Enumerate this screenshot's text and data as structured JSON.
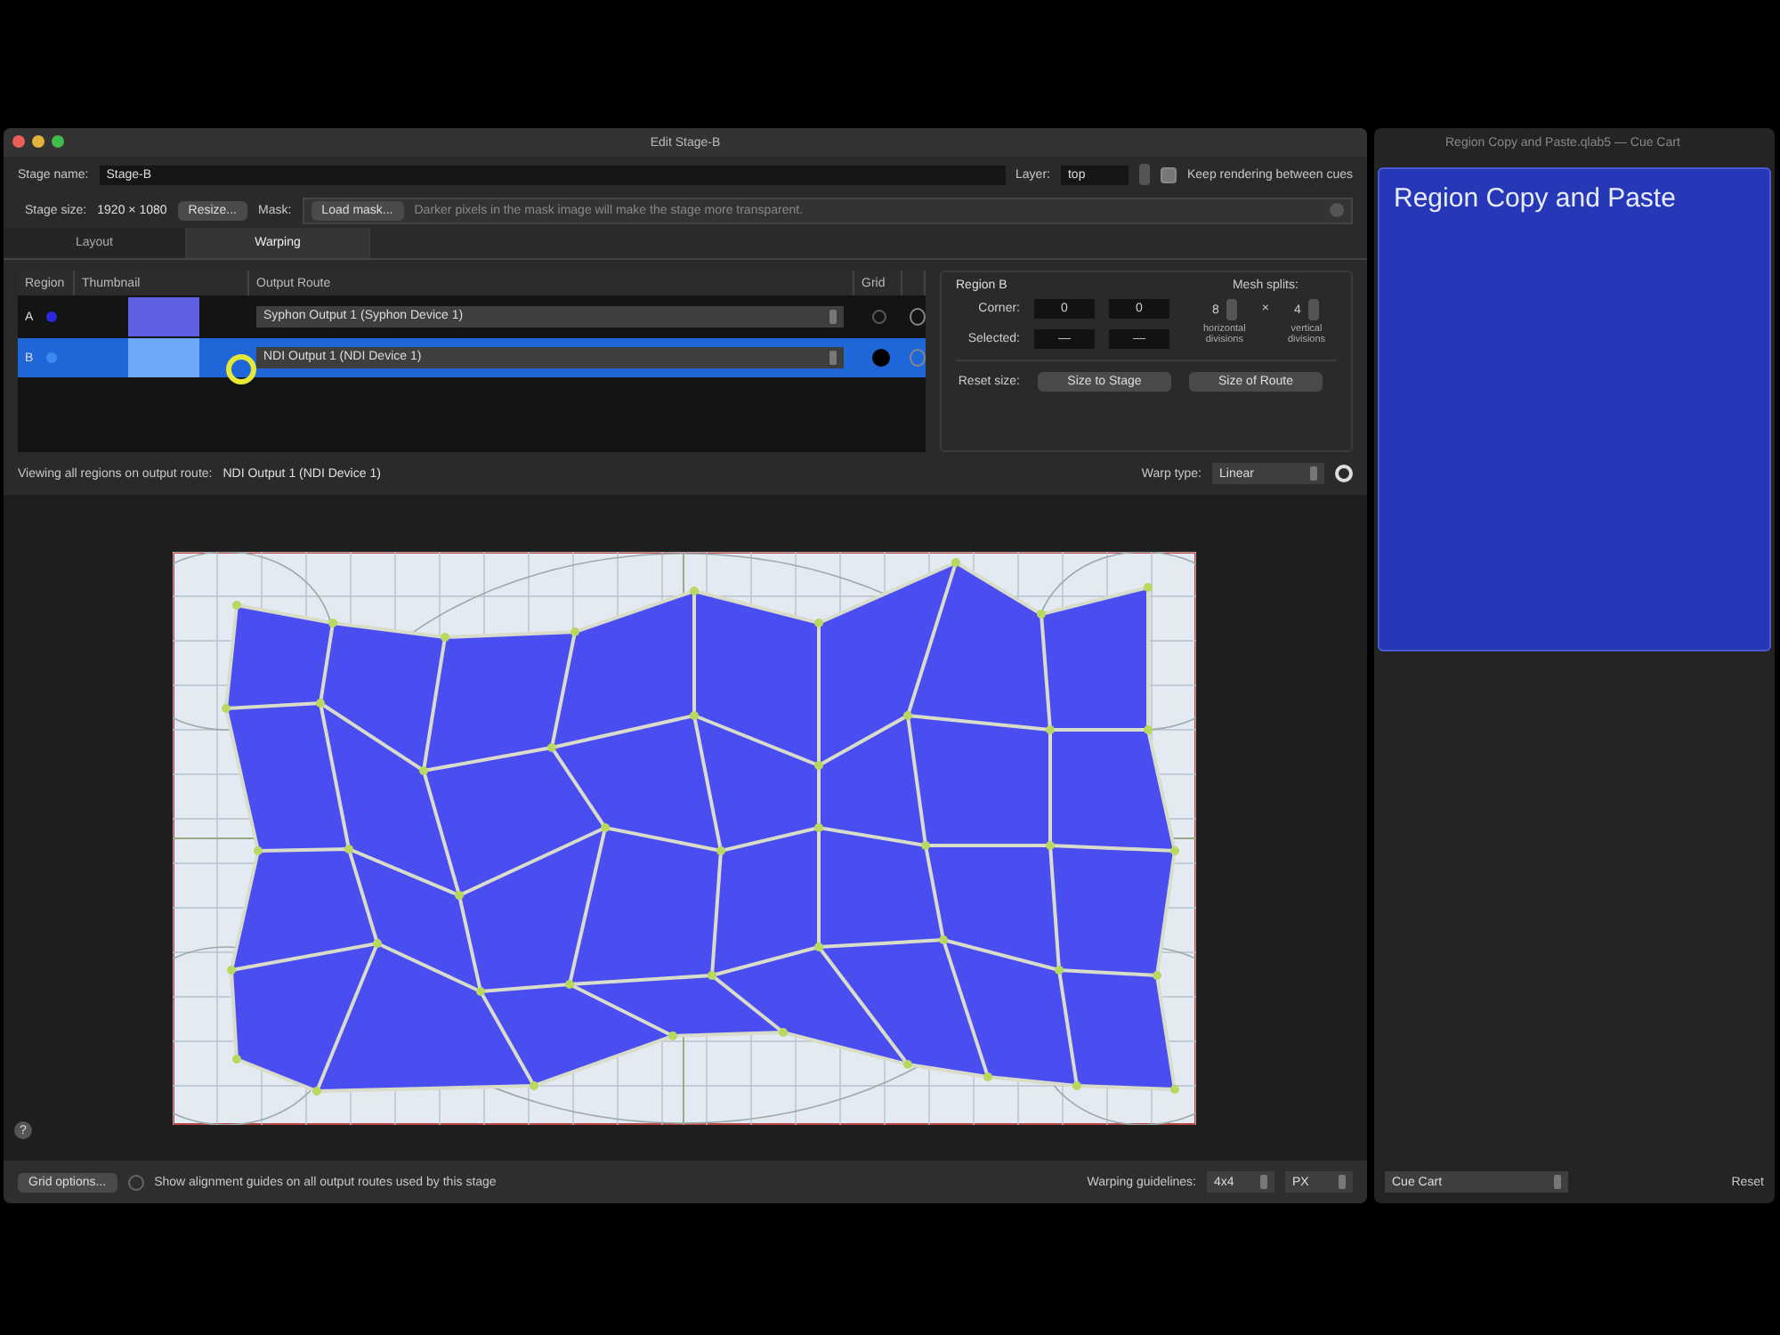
{
  "window": {
    "title": "Edit Stage-B"
  },
  "stage_name": {
    "label": "Stage name:",
    "value": "Stage-B"
  },
  "layer": {
    "label": "Layer:",
    "value": "top"
  },
  "keep_rendering": {
    "label": "Keep rendering between cues",
    "checked": true
  },
  "stage_size": {
    "label": "Stage size:",
    "value": "1920 × 1080",
    "button": "Resize..."
  },
  "mask": {
    "label": "Mask:",
    "button": "Load mask...",
    "hint": "Darker pixels in the mask image will make the stage more transparent."
  },
  "tabs": [
    {
      "label": "Layout",
      "selected": false
    },
    {
      "label": "Warping",
      "selected": true
    }
  ],
  "regions": {
    "columns": [
      "Region",
      "Thumbnail",
      "Output Route",
      "Grid"
    ],
    "rows": [
      {
        "region": "A",
        "color": "#2a2ad8",
        "route": "Syphon Output 1 (Syphon Device 1)",
        "grid": false,
        "selected": false
      },
      {
        "region": "B",
        "color": "#3a8cf0",
        "route": "NDI Output 1 (NDI Device 1)",
        "grid": true,
        "selected": true
      }
    ]
  },
  "viewing": {
    "label": "Viewing all regions on output route:",
    "value": "NDI Output 1 (NDI Device 1)"
  },
  "region_panel": {
    "title": "Region B",
    "corner_label": "Corner:",
    "corner": [
      "0",
      "0"
    ],
    "selected_label": "Selected:",
    "selected_values": [
      "—",
      "—"
    ],
    "mesh_label": "Mesh splits:",
    "h_splits": "8",
    "times": "×",
    "v_splits": "4",
    "h_caption": "horizontal divisions",
    "v_caption": "vertical divisions",
    "reset_label": "Reset size:",
    "reset_buttons": [
      "Size to Stage",
      "Size of Route"
    ]
  },
  "warp_type": {
    "label": "Warp type:",
    "value": "Linear"
  },
  "help": "?",
  "footer": {
    "grid_button": "Grid options...",
    "guides_label": "Show alignment guides on all output routes used by this stage",
    "guides_checked": false,
    "guidelines_label": "Warping guidelines:",
    "guidelines": "4x4",
    "units": "PX"
  },
  "side_window": {
    "title": "Region Copy and Paste.qlab5 — Cue Cart",
    "cue": "Region Copy and Paste",
    "cart": "Cue Cart",
    "reset": "Reset"
  }
}
